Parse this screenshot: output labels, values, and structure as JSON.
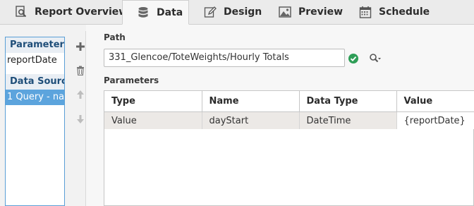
{
  "tabs": [
    {
      "label": "Report Overview",
      "icon": "magnifier-doc-icon"
    },
    {
      "label": "Data",
      "icon": "database-icon",
      "active": true
    },
    {
      "label": "Design",
      "icon": "pencil-icon"
    },
    {
      "label": "Preview",
      "icon": "image-icon"
    },
    {
      "label": "Schedule",
      "icon": "calendar-icon"
    }
  ],
  "sidebar": {
    "parameters_header": "Parameters",
    "parameters": [
      "reportDate"
    ],
    "datasources_header": "Data Sources",
    "datasources": [
      "1 Query - na..."
    ]
  },
  "main": {
    "path_label": "Path",
    "path_value": "331_Glencoe/ToteWeights/Hourly Totals",
    "parameters_label": "Parameters",
    "table": {
      "columns": [
        "Type",
        "Name",
        "Data Type",
        "Value"
      ],
      "rows": [
        [
          "Value",
          "dayStart",
          "DateTime",
          "{reportDate}"
        ]
      ]
    }
  },
  "colors": {
    "selection": "#5ca4dd",
    "accent_green": "#2e9e57",
    "header_text": "#1f4e79"
  }
}
